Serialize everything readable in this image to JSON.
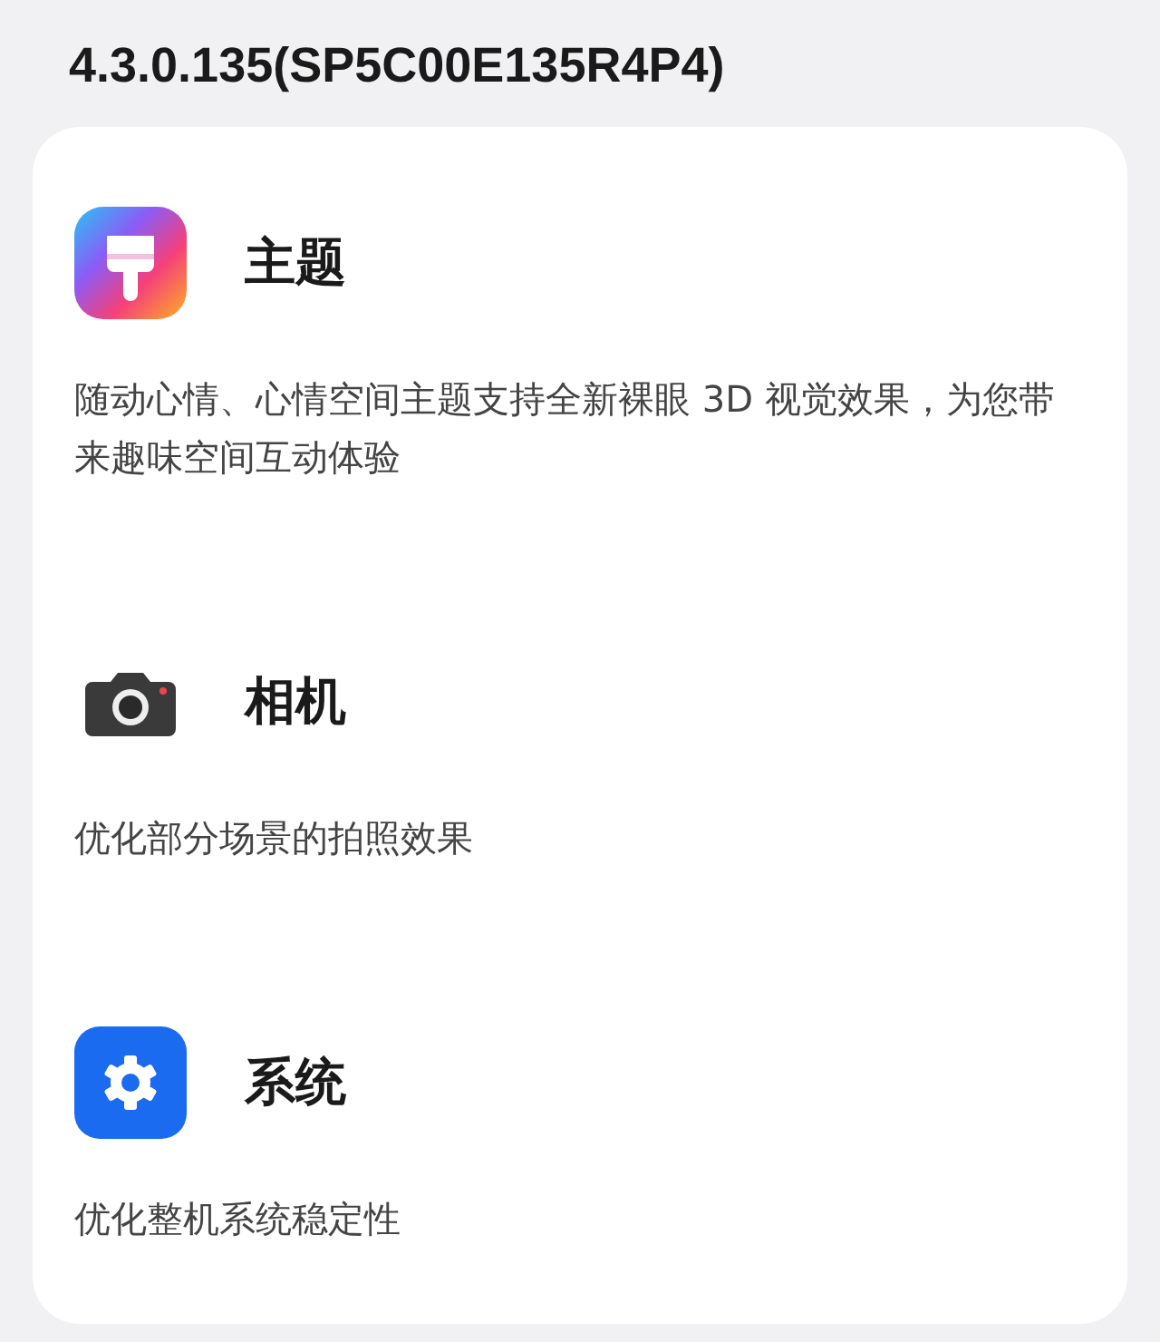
{
  "version_title": "4.3.0.135(SP5C00E135R4P4)",
  "items": [
    {
      "kind": "theme",
      "title": "主题",
      "description": "随动心情、心情空间主题支持全新裸眼 3D 视觉效果，为您带来趣味空间互动体验"
    },
    {
      "kind": "camera",
      "title": "相机",
      "description": "优化部分场景的拍照效果"
    },
    {
      "kind": "system",
      "title": "系统",
      "description": "优化整机系统稳定性"
    }
  ]
}
